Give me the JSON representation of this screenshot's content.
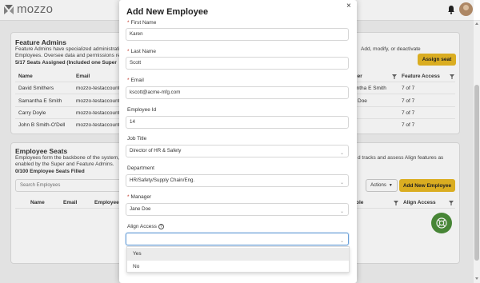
{
  "app": {
    "logo_text": "mozzo"
  },
  "feature_admins": {
    "title": "Feature Admins",
    "desc_line1": "Feature Admins have specialized administrative",
    "desc_line2": "Employees. Oversee data and permissions relat",
    "right_desc_line1": "Add, modify, or deactivate",
    "count_text": "5/17 Seats Assigned (Included one Super",
    "assign_button": "Assign seat",
    "columns": {
      "name": "Name",
      "email": "Email",
      "manager": "ager",
      "feature_access": "Feature Access"
    },
    "rows": [
      {
        "name": "David Smithers",
        "email": "mozzo-testaccount",
        "manager": "antha E Smith",
        "access": "7 of 7"
      },
      {
        "name": "Samantha E Smith",
        "email": "mozzo-testaccount",
        "manager": "Doe",
        "access": "7 of 7"
      },
      {
        "name": "Carry Doyle",
        "email": "mozzo-testaccount",
        "manager": "",
        "access": "7 of 7"
      },
      {
        "name": "John B Smith-O'Dell",
        "email": "mozzo-testaccount",
        "manager": "",
        "access": "7 of 7"
      }
    ]
  },
  "employee_seats": {
    "title": "Employee Seats",
    "desc_line1": "Employees form the backbone of the system, v",
    "desc_line2": "enabled by the Super and Feature Admins.",
    "right_desc_line1": "d tracks and assess Align features as",
    "count_text": "0/100 Employee Seats Filled",
    "search_placeholder": "Search Employees",
    "actions_label": "Actions",
    "add_button": "Add New Employee",
    "columns": {
      "name": "Name",
      "email": "Email",
      "employee": "Employee",
      "role": "ole",
      "align_access": "Align Access"
    }
  },
  "modal": {
    "title": "Add New Employee",
    "close_glyph": "×",
    "fields": {
      "first_name": {
        "label": "First Name",
        "required": "*",
        "value": "Karen"
      },
      "last_name": {
        "label": "Last Name",
        "required": "*",
        "value": "Scott"
      },
      "email": {
        "label": "Email",
        "required": "*",
        "value": "kscott@acme-mfg.com"
      },
      "employee_id": {
        "label": "Employee Id",
        "value": "14"
      },
      "job_title": {
        "label": "Job Title",
        "value": "Director of HR & Safety"
      },
      "department": {
        "label": "Department",
        "value": "HR/Safety/Supply Chain/Eng."
      },
      "manager": {
        "label": "Manager",
        "required": "*",
        "value": "Jane Doe"
      },
      "align_access": {
        "label": "Align Access",
        "value": ""
      }
    },
    "dropdown_options": [
      "Yes",
      "No"
    ]
  },
  "colors": {
    "accent_yellow": "#e8b824",
    "help_green": "#4c8e3a",
    "focus_blue": "#6aa0d8"
  }
}
